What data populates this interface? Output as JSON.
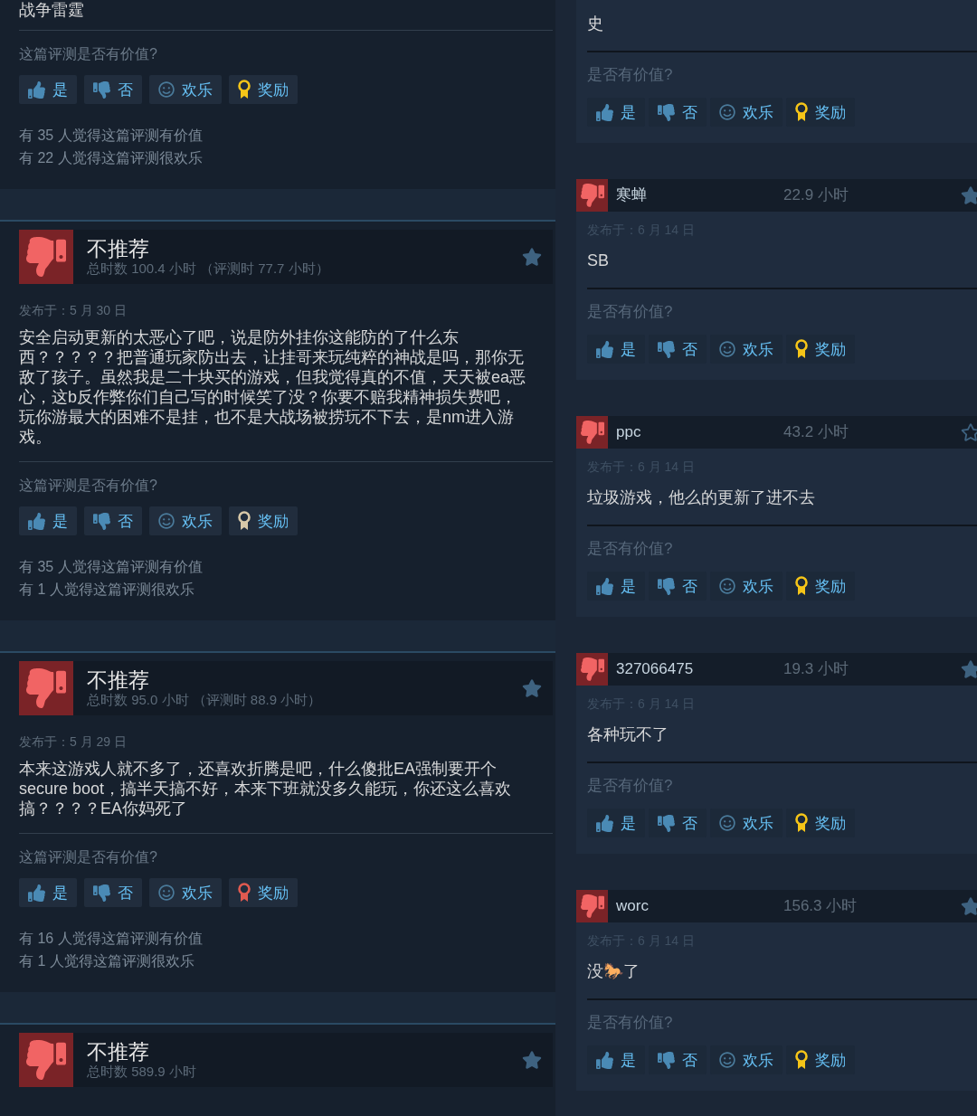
{
  "left_reviews": [
    {
      "body": "战争雷霆",
      "question": "这篇评测是否有价值?",
      "buttons": [
        {
          "kind": "yes",
          "label": "是"
        },
        {
          "kind": "no",
          "label": "否"
        },
        {
          "kind": "funny",
          "label": "欢乐"
        },
        {
          "kind": "award",
          "label": "奖励",
          "color": "#f5c518"
        }
      ],
      "counts": [
        "有 35 人觉得这篇评测有价值",
        "有 22 人觉得这篇评测很欢乐"
      ]
    },
    {
      "title": "不推荐",
      "playtime": "总时数 100.4 小时 （评测时 77.7 小时）",
      "star_filled": true,
      "date": "发布于：5 月 30 日",
      "body": "安全启动更新的太恶心了吧，说是防外挂你这能防的了什么东西？？？？？把普通玩家防出去，让挂哥来玩纯粹的神战是吗，那你无敌了孩子。虽然我是二十块买的游戏，但我觉得真的不值，天天被ea恶心，这b反作弊你们自己写的时候笑了没？你要不赔我精神损失费吧，玩你游最大的困难不是挂，也不是大战场被捞玩不下去，是nm进入游戏。",
      "question": "这篇评测是否有价值?",
      "buttons": [
        {
          "kind": "yes",
          "label": "是"
        },
        {
          "kind": "no",
          "label": "否"
        },
        {
          "kind": "funny",
          "label": "欢乐"
        },
        {
          "kind": "award",
          "label": "奖励",
          "color": "#d8c8a8"
        }
      ],
      "counts": [
        "有 35 人觉得这篇评测有价值",
        "有 1 人觉得这篇评测很欢乐"
      ]
    },
    {
      "title": "不推荐",
      "playtime": "总时数 95.0 小时 （评测时 88.9 小时）",
      "star_filled": true,
      "date": "发布于：5 月 29 日",
      "body": "本来这游戏人就不多了，还喜欢折腾是吧，什么傻批EA强制要开个secure boot，搞半天搞不好，本来下班就没多久能玩，你还这么喜欢搞？？？？EA你妈死了",
      "question": "这篇评测是否有价值?",
      "buttons": [
        {
          "kind": "yes",
          "label": "是"
        },
        {
          "kind": "no",
          "label": "否"
        },
        {
          "kind": "funny",
          "label": "欢乐"
        },
        {
          "kind": "award",
          "label": "奖励",
          "color": "#e05a50"
        }
      ],
      "counts": [
        "有 16 人觉得这篇评测有价值",
        "有 1 人觉得这篇评测很欢乐"
      ]
    },
    {
      "title": "不推荐",
      "playtime": "总时数 589.9 小时",
      "star_filled": true
    }
  ],
  "right_reviews": [
    {
      "body": "史",
      "question": "是否有价值?",
      "buttons": [
        {
          "kind": "yes",
          "label": "是"
        },
        {
          "kind": "no",
          "label": "否"
        },
        {
          "kind": "funny",
          "label": "欢乐"
        },
        {
          "kind": "award",
          "label": "奖励",
          "color": "#f5c518"
        }
      ]
    },
    {
      "user": "寒蝉",
      "hours": "22.9 小时",
      "star_filled": true,
      "date": "发布于：6 月 14 日",
      "body": "SB",
      "question": "是否有价值?",
      "buttons": [
        {
          "kind": "yes",
          "label": "是"
        },
        {
          "kind": "no",
          "label": "否"
        },
        {
          "kind": "funny",
          "label": "欢乐"
        },
        {
          "kind": "award",
          "label": "奖励",
          "color": "#f5c518"
        }
      ]
    },
    {
      "user": "ppc",
      "hours": "43.2 小时",
      "star_filled": false,
      "date": "发布于：6 月 14 日",
      "body": "垃圾游戏，他么的更新了进不去",
      "question": "是否有价值?",
      "buttons": [
        {
          "kind": "yes",
          "label": "是"
        },
        {
          "kind": "no",
          "label": "否"
        },
        {
          "kind": "funny",
          "label": "欢乐"
        },
        {
          "kind": "award",
          "label": "奖励",
          "color": "#f5c518"
        }
      ]
    },
    {
      "user": "327066475",
      "hours": "19.3 小时",
      "star_filled": true,
      "date": "发布于：6 月 14 日",
      "body": "各种玩不了",
      "question": "是否有价值?",
      "buttons": [
        {
          "kind": "yes",
          "label": "是"
        },
        {
          "kind": "no",
          "label": "否"
        },
        {
          "kind": "funny",
          "label": "欢乐"
        },
        {
          "kind": "award",
          "label": "奖励",
          "color": "#f5c518"
        }
      ]
    },
    {
      "user": "worc",
      "hours": "156.3 小时",
      "star_filled": true,
      "date": "发布于：6 月 14 日",
      "body": "没🐎了",
      "question": "是否有价值?",
      "buttons": [
        {
          "kind": "yes",
          "label": "是"
        },
        {
          "kind": "no",
          "label": "否"
        },
        {
          "kind": "funny",
          "label": "欢乐"
        },
        {
          "kind": "award",
          "label": "奖励",
          "color": "#f5c518"
        }
      ]
    }
  ]
}
